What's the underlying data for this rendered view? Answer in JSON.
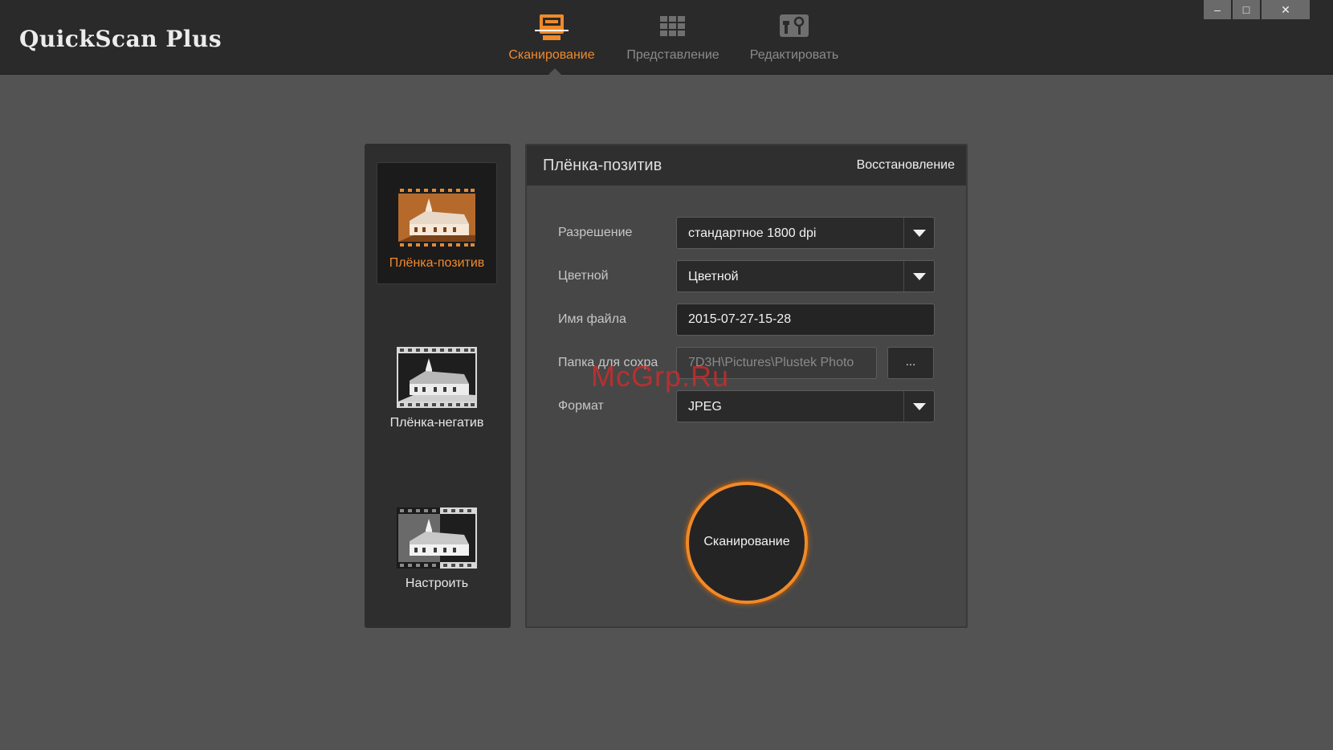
{
  "app": {
    "title": "QuickScan Plus"
  },
  "nav": {
    "tabs": [
      {
        "label": "Сканирование",
        "icon": "scanner-icon",
        "active": true
      },
      {
        "label": "Представление",
        "icon": "grid-view-icon",
        "active": false
      },
      {
        "label": "Редактировать",
        "icon": "edit-tools-icon",
        "active": false
      }
    ]
  },
  "window_controls": {
    "minimize": "–",
    "maximize": "□",
    "close": "✕"
  },
  "modes": [
    {
      "label": "Плёнка-позитив",
      "icon": "film-positive-icon",
      "active": true
    },
    {
      "label": "Плёнка-негатив",
      "icon": "film-negative-icon",
      "active": false
    },
    {
      "label": "Настроить",
      "icon": "film-custom-icon",
      "active": false
    }
  ],
  "settings": {
    "title": "Плёнка-позитив",
    "restore_label": "Восстановление",
    "resolution": {
      "label": "Разрешение",
      "value": "стандартное 1800 dpi"
    },
    "color": {
      "label": "Цветной",
      "value": "Цветной"
    },
    "filename": {
      "label": "Имя файла",
      "value": "2015-07-27-15-28"
    },
    "folder": {
      "label": "Папка для сохра",
      "value": "7D3H\\Pictures\\Plustek Photo",
      "browse_label": "..."
    },
    "format": {
      "label": "Формат",
      "value": "JPEG"
    }
  },
  "scan_button": {
    "label": "Сканирование"
  },
  "watermark": "McGrp.Ru",
  "colors": {
    "accent": "#f08a2a",
    "background": "#535353",
    "titlebar": "#2a2a2a"
  }
}
